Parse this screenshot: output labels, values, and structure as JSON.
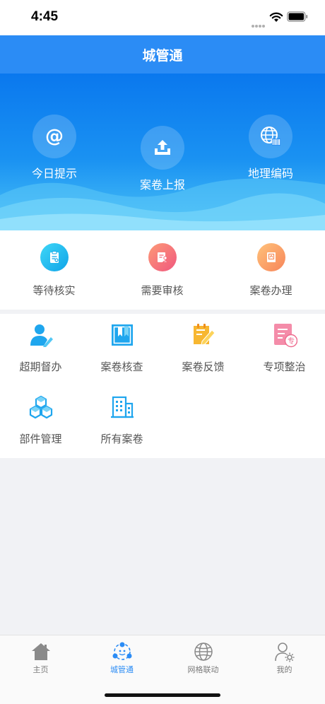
{
  "status": {
    "time": "4:45"
  },
  "header": {
    "title": "城管通"
  },
  "hero": [
    {
      "label": "今日提示",
      "icon": "at-icon"
    },
    {
      "label": "案卷上报",
      "icon": "upload-icon"
    },
    {
      "label": "地理编码",
      "icon": "globe-barcode-icon"
    }
  ],
  "tasks": [
    {
      "label": "等待核实",
      "icon": "clipboard-icon",
      "color": "#19b8ef"
    },
    {
      "label": "需要审核",
      "icon": "document-person-icon",
      "color": "#f36f79"
    },
    {
      "label": "案卷办理",
      "icon": "archive-icon",
      "color": "#fb9a5a"
    }
  ],
  "grid": [
    {
      "label": "超期督办",
      "icon": "user-edit-icon"
    },
    {
      "label": "案卷核查",
      "icon": "bookmark-book-icon"
    },
    {
      "label": "案卷反馈",
      "icon": "note-pencil-icon"
    },
    {
      "label": "专项整治",
      "icon": "special-document-icon"
    },
    {
      "label": "部件管理",
      "icon": "cubes-icon"
    },
    {
      "label": "所有案卷",
      "icon": "building-icon"
    }
  ],
  "tabs": [
    {
      "label": "主页",
      "icon": "home-icon",
      "active": false
    },
    {
      "label": "城管通",
      "icon": "people-network-icon",
      "active": true
    },
    {
      "label": "网格联动",
      "icon": "globe-icon",
      "active": false
    },
    {
      "label": "我的",
      "icon": "user-settings-icon",
      "active": false
    }
  ],
  "colors": {
    "primary": "#2b8cf5",
    "tab_active": "#2b8cf5",
    "tab_inactive": "#7a7a7a"
  }
}
